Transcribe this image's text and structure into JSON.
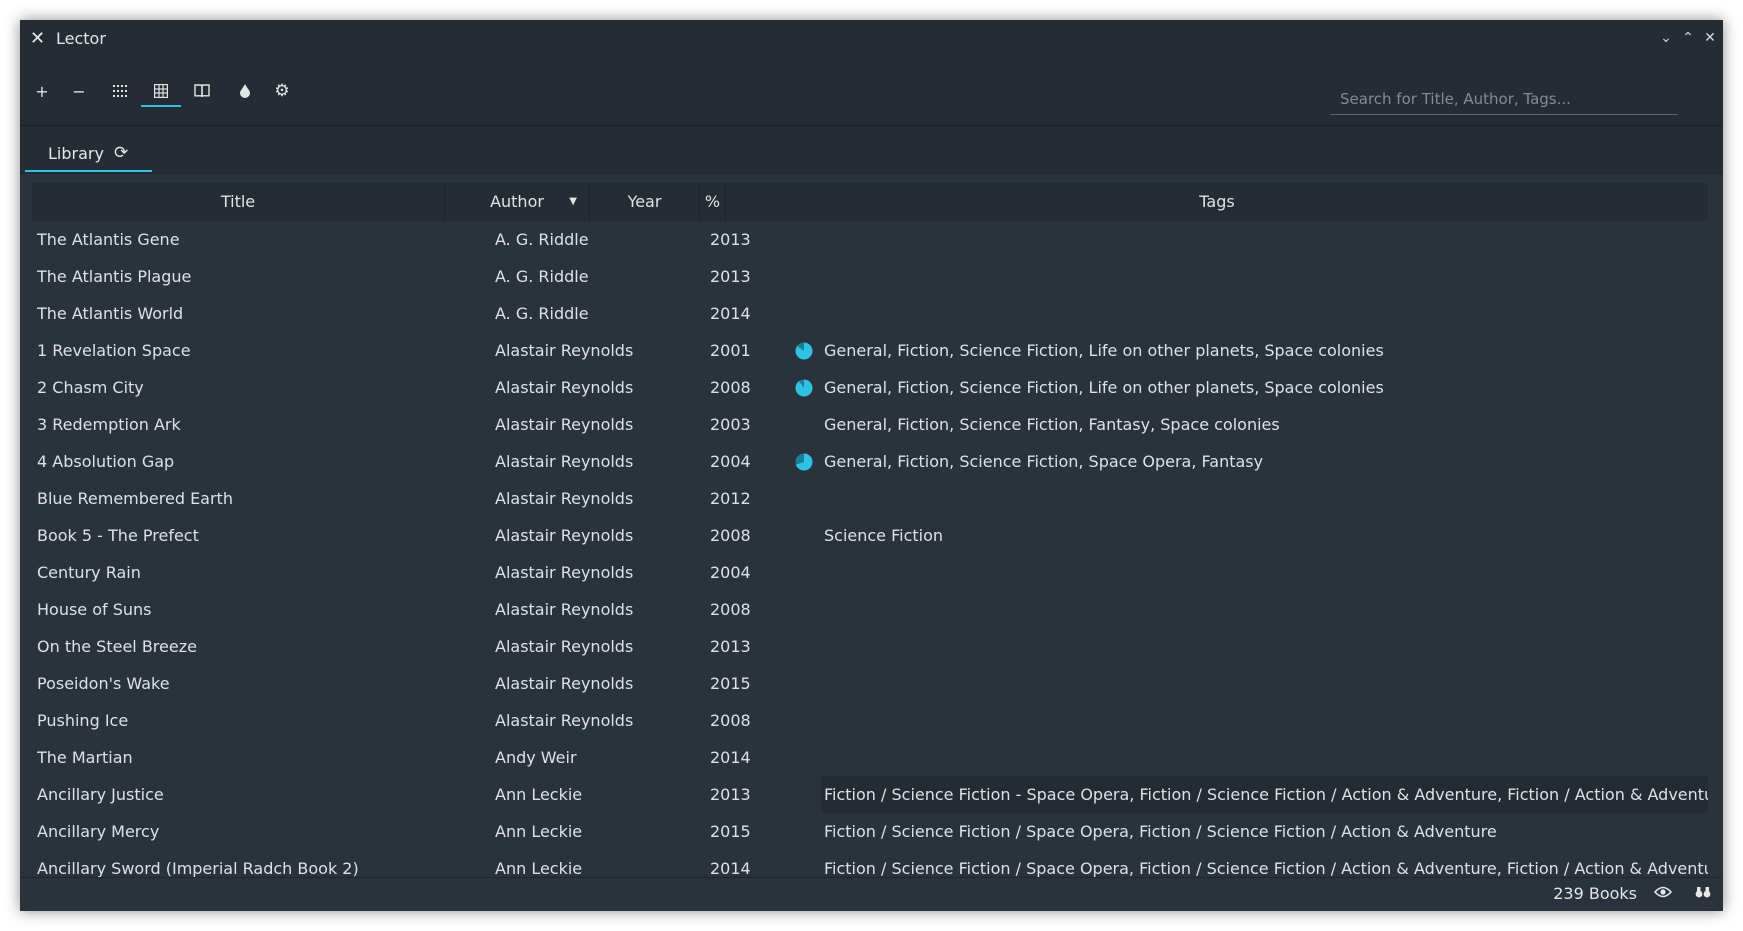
{
  "window": {
    "title": "Lector"
  },
  "toolbar": {
    "add_icon": "plus-icon",
    "remove_icon": "minus-icon",
    "grid_view_icon": "grid-dots-icon",
    "table_view_icon": "table-icon",
    "reading_icon": "book-icon",
    "theme_icon": "droplet-icon",
    "settings_icon": "gear-icon",
    "search_placeholder": "Search for Title, Author, Tags..."
  },
  "tabs": [
    {
      "label": "Library",
      "icon": "refresh-icon"
    }
  ],
  "table": {
    "columns": [
      "Title",
      "Author",
      "Year",
      "%",
      "Tags"
    ],
    "sorted_column": "Author",
    "rows": [
      {
        "title": "The Atlantis Gene",
        "author": "A. G. Riddle",
        "year": "2013",
        "progress": null,
        "tags": ""
      },
      {
        "title": "The Atlantis Plague",
        "author": "A. G. Riddle",
        "year": "2013",
        "progress": null,
        "tags": ""
      },
      {
        "title": "The Atlantis World",
        "author": "A. G. Riddle",
        "year": "2014",
        "progress": null,
        "tags": ""
      },
      {
        "title": "1 Revelation Space",
        "author": "Alastair Reynolds",
        "year": "2001",
        "progress": 0.85,
        "tags": "General, Fiction, Science Fiction, Life on other planets, Space colonies"
      },
      {
        "title": "2 Chasm City",
        "author": "Alastair Reynolds",
        "year": "2008",
        "progress": 0.9,
        "tags": "General, Fiction, Science Fiction, Life on other planets, Space colonies"
      },
      {
        "title": "3 Redemption Ark",
        "author": "Alastair Reynolds",
        "year": "2003",
        "progress": null,
        "tags": "General, Fiction, Science Fiction, Fantasy, Space colonies"
      },
      {
        "title": "4 Absolution Gap",
        "author": "Alastair Reynolds",
        "year": "2004",
        "progress": 0.7,
        "tags": "General, Fiction, Science Fiction, Space Opera, Fantasy"
      },
      {
        "title": "Blue Remembered Earth",
        "author": "Alastair Reynolds",
        "year": "2012",
        "progress": null,
        "tags": ""
      },
      {
        "title": "Book 5 - The Prefect",
        "author": "Alastair Reynolds",
        "year": "2008",
        "progress": null,
        "tags": "Science Fiction"
      },
      {
        "title": "Century Rain",
        "author": "Alastair Reynolds",
        "year": "2004",
        "progress": null,
        "tags": ""
      },
      {
        "title": "House of Suns",
        "author": "Alastair Reynolds",
        "year": "2008",
        "progress": null,
        "tags": ""
      },
      {
        "title": "On the Steel Breeze",
        "author": "Alastair Reynolds",
        "year": "2013",
        "progress": null,
        "tags": ""
      },
      {
        "title": "Poseidon's Wake",
        "author": "Alastair Reynolds",
        "year": "2015",
        "progress": null,
        "tags": ""
      },
      {
        "title": "Pushing Ice",
        "author": "Alastair Reynolds",
        "year": "2008",
        "progress": null,
        "tags": ""
      },
      {
        "title": "The Martian",
        "author": "Andy Weir",
        "year": "2014",
        "progress": null,
        "tags": ""
      },
      {
        "title": "Ancillary Justice",
        "author": "Ann Leckie",
        "year": "2013",
        "progress": null,
        "tags": "Fiction / Science Fiction - Space Opera, Fiction / Science Fiction / Action & Adventure, Fiction / Action & Adventure",
        "selected": true
      },
      {
        "title": "Ancillary Mercy",
        "author": "Ann Leckie",
        "year": "2015",
        "progress": null,
        "tags": "Fiction / Science Fiction / Space Opera, Fiction / Science Fiction / Action & Adventure"
      },
      {
        "title": "Ancillary Sword (Imperial Radch Book 2)",
        "author": "Ann Leckie",
        "year": "2014",
        "progress": null,
        "tags": "Fiction / Science Fiction / Space Opera, Fiction / Science Fiction / Action & Adventure, Fiction / Action & Adventure"
      }
    ]
  },
  "status": {
    "book_count": "239 Books",
    "eye_icon": "eye-icon",
    "binoculars_icon": "binoculars-icon"
  },
  "colors": {
    "accent": "#2ec2e4",
    "background": "#2a323b",
    "bar": "#252c33"
  }
}
